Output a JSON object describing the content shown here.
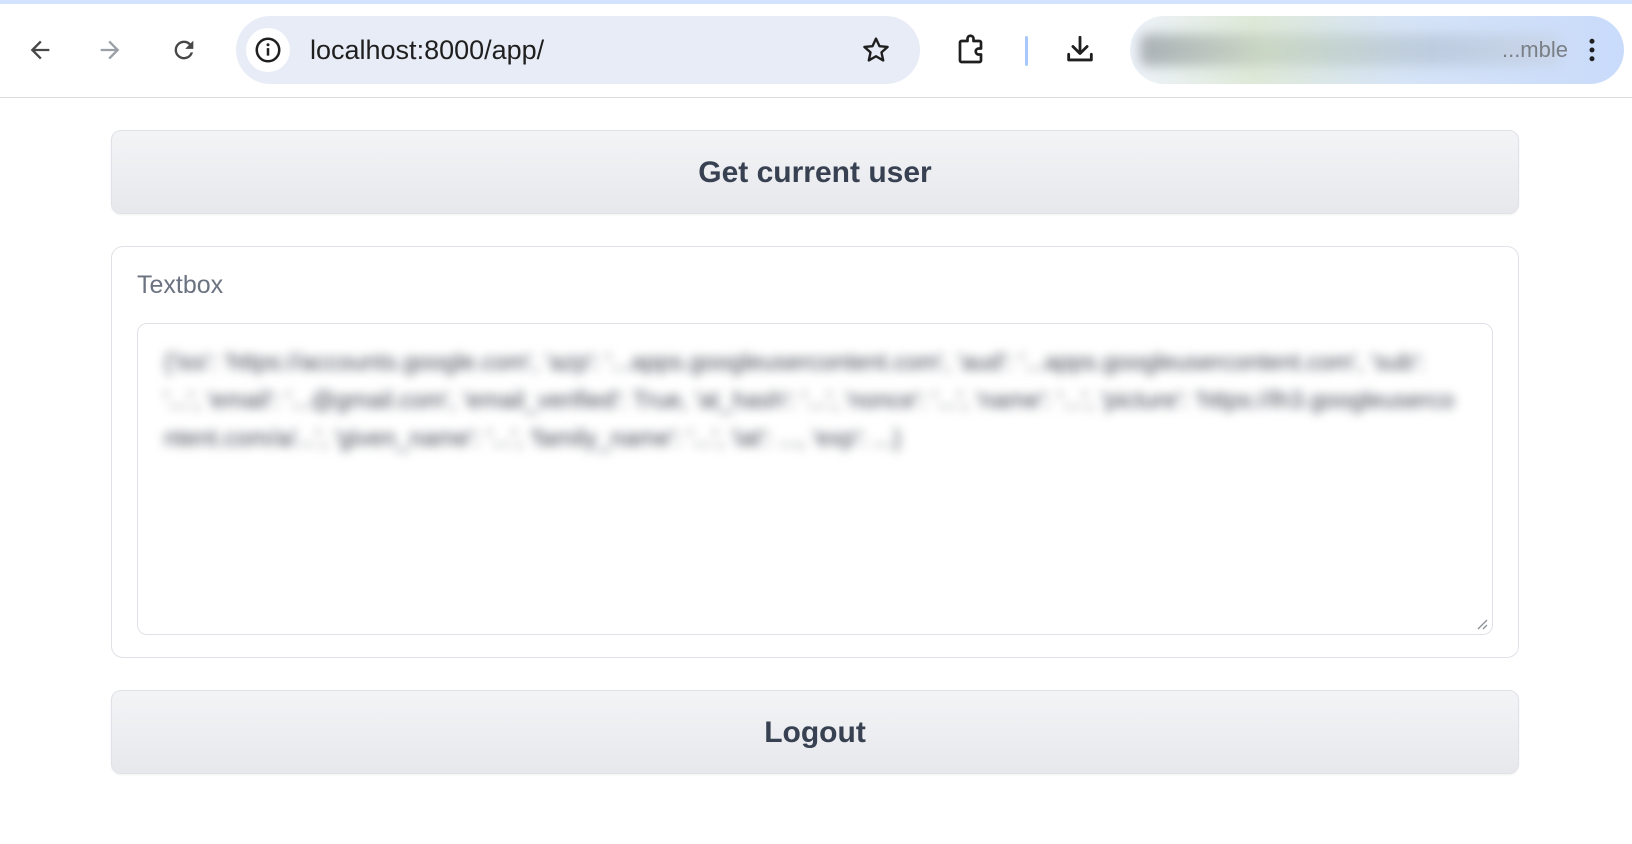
{
  "browser": {
    "url": "localhost:8000/app/",
    "profile_text": "...mble"
  },
  "icons": {
    "back": "arrow-left-icon",
    "forward": "arrow-right-icon",
    "reload": "reload-icon",
    "site_info": "info-circle-icon",
    "bookmark": "star-icon",
    "extensions": "puzzle-icon",
    "downloads": "download-icon",
    "menu": "vertical-dots-icon"
  },
  "colors": {
    "accent": "#d3e3fd",
    "omnibox_bg": "#e8ecf6",
    "button_text": "#374151",
    "label_text": "#6b7280"
  },
  "main": {
    "get_user_button": "Get current user",
    "textbox": {
      "label": "Textbox",
      "value": "{'iss': 'https://accounts.google.com', 'azp': '...apps.googleusercontent.com', 'aud': '...apps.googleusercontent.com', 'sub': '...', 'email': '...@gmail.com', 'email_verified': True, 'at_hash': '...', 'nonce': '...', 'name': '...', 'picture': 'https://lh3.googleusercontent.com/a/...', 'given_name': '...', 'family_name': '...', 'iat': ..., 'exp': ...}"
    },
    "logout_button": "Logout"
  }
}
